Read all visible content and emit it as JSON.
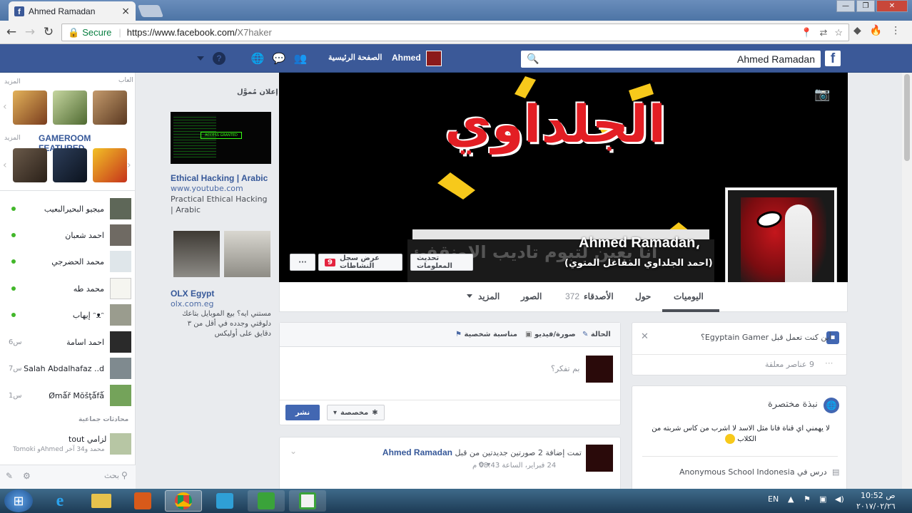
{
  "browser": {
    "tab_title": "Ahmed Ramadan",
    "tab_close": "×",
    "security_label": "Secure",
    "url_host": "https://www.facebook.com/",
    "url_path": "X7haker"
  },
  "fb_header": {
    "search_value": "Ahmed Ramadan",
    "logo_letter": "f",
    "user_name": "Ahmed",
    "home_label": "الصفحة الرئيسية",
    "help_glyph": "?"
  },
  "chat": {
    "recent_label": "العاب",
    "more_label": "المزيد",
    "more_label2": "المزيد",
    "gameroom_label": "GAMEROOM FEATURED",
    "friends": [
      {
        "name": "ميجيو البحيرالبعيب",
        "online": true,
        "time": ""
      },
      {
        "name": "احمد شعبان",
        "online": true,
        "time": ""
      },
      {
        "name": "محمد الحضرجي",
        "online": true,
        "time": ""
      },
      {
        "name": "محمد طه",
        "online": true,
        "time": ""
      },
      {
        "name": "إيهاب ᵔᴥᵔ",
        "online": true,
        "time": ""
      },
      {
        "name": "احمد اسامة",
        "online": false,
        "time": "6س"
      },
      {
        "name": "Salah Abdalhafaz ..d",
        "online": false,
        "time": "7س"
      },
      {
        "name": "Ømǻř Mŏšţǻfǻ",
        "online": false,
        "time": "1س"
      }
    ],
    "group_header": "محادثات جماعية",
    "group_name": "tout لزامي",
    "group_members": "Tomoki وAhmed محمد و34 آخر",
    "search_placeholder": "بحث"
  },
  "ads": {
    "sponsored_label": "إعلان مُموَّل",
    "ad1_title": "Ethical Hacking | Arabic",
    "ad1_url": "www.youtube.com",
    "ad1_desc": "Practical Ethical Hacking | Arabic",
    "ad1_banner": "ACCESS GRANTED",
    "ad2_title": "OLX Egypt",
    "ad2_url": "olx.com.eg",
    "ad2_desc": "مستني ايه؟ بيع الموبايل بتاعك دلوقتي وجدده في أقل من ٣ دقايق على أوليكس"
  },
  "profile": {
    "cover_title": "الجلداوي",
    "cover_subtitle": "انا بعين لتبوم تاديب الاونقفئ",
    "name": "Ahmed Ramadan",
    "name_comma": "،",
    "alt_name": "(احمد الجلداوي المقاعل المتوي)",
    "activity_log_label": "عرض سجل النشاطات",
    "activity_count": "9",
    "update_info_label": "تحديث المعلومات",
    "more_dots": "···",
    "tabs": {
      "timeline": "اليوميات",
      "about": "حول",
      "friends": "الأصدقاء",
      "friends_count": "372",
      "photos": "الصور",
      "more": "المزيد"
    }
  },
  "composer": {
    "status": "الحالة",
    "photo_video": "صورة/فيديو",
    "life_event": "مناسبة شخصية",
    "placeholder": "بم تفكر؟",
    "privacy": "مخصصة",
    "post_button": "نشر"
  },
  "post": {
    "author": "Ahmed Ramadan",
    "action": "تمت إضافة 2 صورتين جديدتين من قبل",
    "date": "24 فبراير، الساعة 08:43 م"
  },
  "right_col": {
    "workplace_prompt": "أين كنت تعمل قبل Egyptain Gamer؟",
    "pending_items": "9 عناصر معلقة",
    "intro_title": "نبذة مختصرة",
    "intro_text": "لا يهمني اي قناة فانا مثل الاسد لا اشرب من كاس شربته من الكلاب",
    "study_line": "درس في Anonymous School Indonesia"
  },
  "taskbar": {
    "lang": "EN",
    "time": "10:52 ص",
    "date": "٢٠١٧/٠٢/٢٦"
  }
}
